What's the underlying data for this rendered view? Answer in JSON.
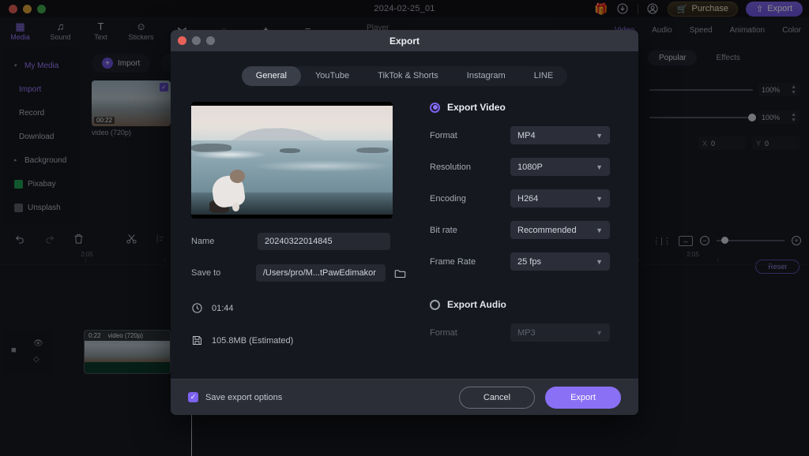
{
  "background_app": {
    "project_title": "2024-02-25_01",
    "window_buttons": [
      "close",
      "minimize",
      "maximize"
    ],
    "top_actions": {
      "gift_icon": "gift-icon",
      "download_icon": "download-icon",
      "account_icon": "account-icon",
      "purchase_label": "Purchase",
      "export_label": "Export"
    },
    "tool_tabs": [
      {
        "label": "Media",
        "icon": "media-icon",
        "active": true
      },
      {
        "label": "Sound",
        "icon": "music-note-icon",
        "active": false
      },
      {
        "label": "Text",
        "icon": "text-icon",
        "active": false
      },
      {
        "label": "Stickers",
        "icon": "sticker-smiley-icon",
        "active": false
      },
      {
        "label": "",
        "icon": "transition-icon",
        "active": false
      },
      {
        "label": "",
        "icon": "filter-icon",
        "active": false
      },
      {
        "label": "",
        "icon": "effects-wand-icon",
        "active": false
      },
      {
        "label": "",
        "icon": "captions-icon",
        "active": false
      }
    ],
    "player_label": "Player",
    "right_tabs": [
      {
        "label": "Video",
        "active": true
      },
      {
        "label": "Audio",
        "active": false
      },
      {
        "label": "Speed",
        "active": false
      },
      {
        "label": "Animation",
        "active": false
      },
      {
        "label": "Color",
        "active": false
      }
    ],
    "sidebar": {
      "items": [
        {
          "label": "My Media",
          "caret": "▾",
          "accent": true
        },
        {
          "label": "Import",
          "accent": true
        },
        {
          "label": "Record",
          "accent": false
        },
        {
          "label": "Download",
          "accent": false
        },
        {
          "label": "Background",
          "caret": "▸",
          "accent": false
        },
        {
          "label": "Pixabay",
          "swatch": "pixabay"
        },
        {
          "label": "Unsplash",
          "swatch": "unsplash"
        }
      ]
    },
    "media_pane": {
      "import_label": "Import",
      "thumb_duration": "00:22",
      "thumb_caption": "video (720p)"
    },
    "properties_panel": {
      "tabs": [
        {
          "label": "Popular",
          "active": true
        },
        {
          "label": "Effects",
          "active": false
        }
      ],
      "slider1_value": "100%",
      "slider2_value": "100%",
      "x_label": "X",
      "x_value": "0",
      "y_label": "Y",
      "y_value": "0",
      "reset_label": "Reset"
    },
    "timeline": {
      "toolbar_icons": [
        "undo-icon",
        "redo-icon",
        "delete-icon",
        "split-scissors-icon",
        "align-icon",
        "speed-icon",
        "crop-icon",
        "copy-icon"
      ],
      "right_icons": [
        "marker-icon",
        "fit-icon",
        "zoom-out-icon",
        "zoom-in-icon"
      ],
      "ruler_labels": [
        "2:05"
      ],
      "track_icons": [
        "eye-icon",
        "lock-icon"
      ],
      "clip": {
        "duration": "0:22",
        "name": "video (720p)"
      }
    }
  },
  "export_dialog": {
    "title": "Export",
    "window_buttons": [
      "close",
      "minimize",
      "maximize"
    ],
    "tabs": [
      {
        "label": "General",
        "active": true
      },
      {
        "label": "YouTube",
        "active": false
      },
      {
        "label": "TikTok & Shorts",
        "active": false
      },
      {
        "label": "Instagram",
        "active": false
      },
      {
        "label": "LINE",
        "active": false
      }
    ],
    "fields": {
      "name_label": "Name",
      "name_value": "20240322014845",
      "saveto_label": "Save to",
      "saveto_value": "/Users/pro/M...tPawEdimakor",
      "folder_icon": "folder-icon"
    },
    "info": {
      "duration_icon": "clock-icon",
      "duration": "01:44",
      "size_icon": "save-disk-icon",
      "size": "105.8MB (Estimated)"
    },
    "video_section": {
      "title": "Export Video",
      "selected": true,
      "options": [
        {
          "label": "Format",
          "value": "MP4"
        },
        {
          "label": "Resolution",
          "value": "1080P"
        },
        {
          "label": "Encoding",
          "value": "H264"
        },
        {
          "label": "Bit rate",
          "value": "Recommended"
        },
        {
          "label": "Frame Rate",
          "value": "25  fps"
        }
      ]
    },
    "audio_section": {
      "title": "Export Audio",
      "selected": false,
      "options": [
        {
          "label": "Format",
          "value": "MP3"
        }
      ]
    },
    "footer": {
      "save_options_label": "Save export options",
      "save_options_checked": true,
      "cancel_label": "Cancel",
      "export_label": "Export"
    }
  },
  "colors": {
    "accent_purple": "#8a70f5",
    "dialog_bg": "#16181f",
    "dialog_titlebar": "#33363f",
    "footer_bg": "#2b2e37"
  }
}
